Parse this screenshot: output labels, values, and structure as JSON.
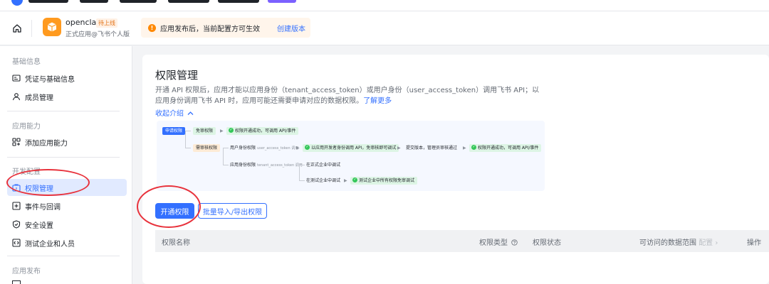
{
  "header": {
    "app_name": "openclaw",
    "app_status": "待上线",
    "app_subtitle": "正式应用@飞书个人版",
    "notice_text": "应用发布后，当前配置方可生效",
    "notice_link": "创建版本"
  },
  "sidebar": {
    "sections": [
      {
        "title": "基础信息",
        "items": [
          {
            "label": "凭证与基础信息",
            "icon": "credential-icon"
          },
          {
            "label": "成员管理",
            "icon": "member-icon"
          }
        ]
      },
      {
        "title": "应用能力",
        "items": [
          {
            "label": "添加应用能力",
            "icon": "add-capability-icon"
          }
        ]
      },
      {
        "title": "开发配置",
        "items": [
          {
            "label": "权限管理",
            "icon": "permission-icon",
            "active": true
          },
          {
            "label": "事件与回调",
            "icon": "event-icon"
          },
          {
            "label": "安全设置",
            "icon": "shield-icon"
          },
          {
            "label": "测试企业和人员",
            "icon": "test-org-icon"
          }
        ]
      },
      {
        "title": "应用发布",
        "items": []
      }
    ]
  },
  "main": {
    "title": "权限管理",
    "desc": "开通 API 权限后，应用才能以应用身份（tenant_access_token）或用户身份（user_access_token）调用飞书 API；以应用身份调用飞书 API 时，应用可能还需要申请对应的数据权限。",
    "desc_link": "了解更多",
    "collapse": "收起介绍",
    "flow": {
      "apply": "申请权限",
      "free_scope": "免审权限",
      "free_result": "权限开通成功，可调用 API/事件",
      "review_scope": "需审核权限",
      "user_scope": "用户身份权限",
      "user_token": "user_access_token 调用",
      "dev_call": "以应用开发者身份调用 API，免审核即可调试",
      "submit": "提交版本，管理员审核通过",
      "review_result": "权限开通成功，可调用 API/事件",
      "app_scope": "应用身份权限",
      "tenant_token": "tenant_access_token 调用",
      "prod_debug": "在正式企业中调试",
      "test_debug": "在测试企业中调试",
      "test_result": "测试企业中所有权限免审调试"
    },
    "btn_enable": "开通权限",
    "btn_batch": "批量导入/导出权限",
    "table": {
      "name": "权限名称",
      "type": "权限类型",
      "status": "权限状态",
      "scope": "可访问的数据范围",
      "config": "配置",
      "action": "操作"
    }
  },
  "colors": {
    "primary": "#3370ff",
    "annotation": "#e8323c",
    "warning": "#ff8800",
    "success": "#34c759"
  }
}
